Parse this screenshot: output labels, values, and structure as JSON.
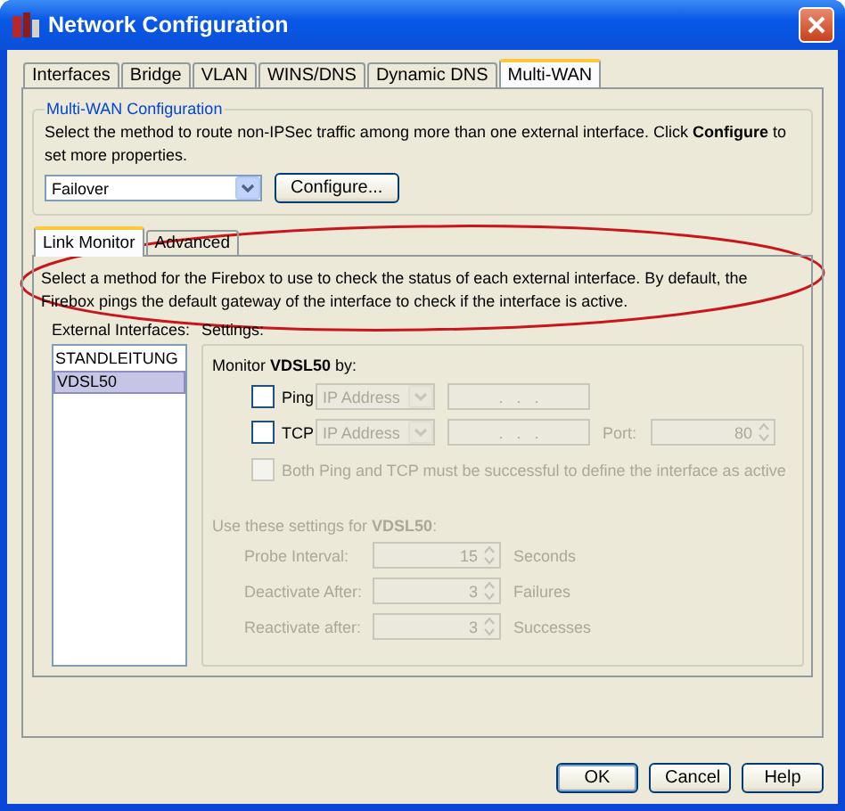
{
  "window": {
    "title": "Network Configuration"
  },
  "tabs": [
    {
      "label": "Interfaces",
      "selected": false
    },
    {
      "label": "Bridge",
      "selected": false
    },
    {
      "label": "VLAN",
      "selected": false
    },
    {
      "label": "WINS/DNS",
      "selected": false
    },
    {
      "label": "Dynamic DNS",
      "selected": false
    },
    {
      "label": "Multi-WAN",
      "selected": true
    }
  ],
  "multi_wan": {
    "title": "Multi-WAN Configuration",
    "description": "Select the method to route non-IPSec traffic among more than one external interface. Click **Configure** to set more properties.",
    "method": "Failover",
    "configure_button": "Configure..."
  },
  "sub_tabs": [
    {
      "label": "Link Monitor",
      "selected": true
    },
    {
      "label": "Advanced",
      "selected": false
    }
  ],
  "link_monitor": {
    "description": "Select a method for the Firebox to use to check the status of each external interface. By default, the Firebox pings the default gateway of the interface to check if the interface is active.",
    "interfaces_label": "External Interfaces:",
    "settings_label": "Settings:",
    "interfaces": [
      {
        "name": "STANDLEITUNG",
        "selected": false
      },
      {
        "name": "VDSL50",
        "selected": true
      }
    ],
    "monitor_heading": "Monitor **VDSL50** by:",
    "probes": [
      {
        "label": "Ping",
        "checked": false,
        "type": "IP Address",
        "address": ".   .   .",
        "disabled": true
      },
      {
        "label": "TCP",
        "checked": false,
        "type": "IP Address",
        "address": ".   .   .",
        "disabled": true,
        "port_label": "Port:",
        "port": "80"
      }
    ],
    "both_option": {
      "label": "Both Ping and TCP must be successful to define the interface as active",
      "checked": false,
      "disabled": true
    },
    "use_heading": "Use these settings for **VDSL50**:",
    "timers_disabled": true,
    "timers": [
      {
        "label": "Probe Interval:",
        "value": "15",
        "unit": "Seconds"
      },
      {
        "label": "Deactivate After:",
        "value": "3",
        "unit": "Failures"
      },
      {
        "label": "Reactivate after:",
        "value": "3",
        "unit": "Successes"
      }
    ]
  },
  "buttons": [
    "OK",
    "Cancel",
    "Help"
  ]
}
